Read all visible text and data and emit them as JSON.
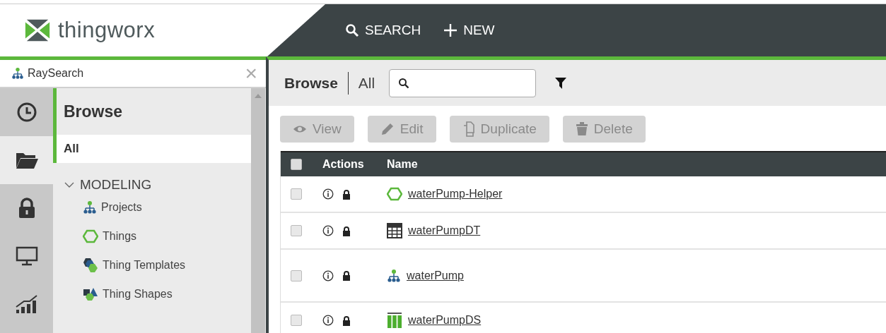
{
  "header": {
    "logo_text": "thingworx",
    "actions": [
      {
        "kind": "search",
        "label": "SEARCH"
      },
      {
        "kind": "new",
        "label": "NEW"
      }
    ]
  },
  "project": {
    "name": "RaySearch",
    "close": "×"
  },
  "rail": [
    {
      "kind": "clock",
      "selected": false
    },
    {
      "kind": "folder",
      "selected": true
    },
    {
      "kind": "lock",
      "selected": false
    },
    {
      "kind": "monitor",
      "selected": false
    },
    {
      "kind": "chart",
      "selected": false
    }
  ],
  "nav": {
    "title": "Browse",
    "items": [
      {
        "label": "All",
        "selected": true
      }
    ],
    "sections": [
      {
        "label": "MODELING",
        "expanded": true,
        "children": [
          {
            "kind": "projects",
            "label": "Projects"
          },
          {
            "kind": "thing",
            "label": "Things"
          },
          {
            "kind": "template",
            "label": "Thing Templates"
          },
          {
            "kind": "shape",
            "label": "Thing Shapes"
          }
        ]
      }
    ]
  },
  "breadcrumb": {
    "title": "Browse",
    "current": "All"
  },
  "toolbar": [
    {
      "kind": "view",
      "label": "View",
      "disabled": true
    },
    {
      "kind": "edit",
      "label": "Edit",
      "disabled": true
    },
    {
      "kind": "duplicate",
      "label": "Duplicate",
      "disabled": true
    },
    {
      "kind": "delete",
      "label": "Delete",
      "disabled": true
    }
  ],
  "table": {
    "select_all": {
      "checked": false
    },
    "columns": [
      "Actions",
      "Name"
    ],
    "rows": [
      {
        "kind": "thing",
        "name": "waterPump-Helper",
        "checked": false
      },
      {
        "kind": "datatable",
        "name": "waterPumpDT",
        "checked": false
      },
      {
        "kind": "projects",
        "name": "waterPump",
        "checked": false
      },
      {
        "kind": "datashape",
        "name": "waterPumpDS",
        "checked": false
      }
    ]
  }
}
